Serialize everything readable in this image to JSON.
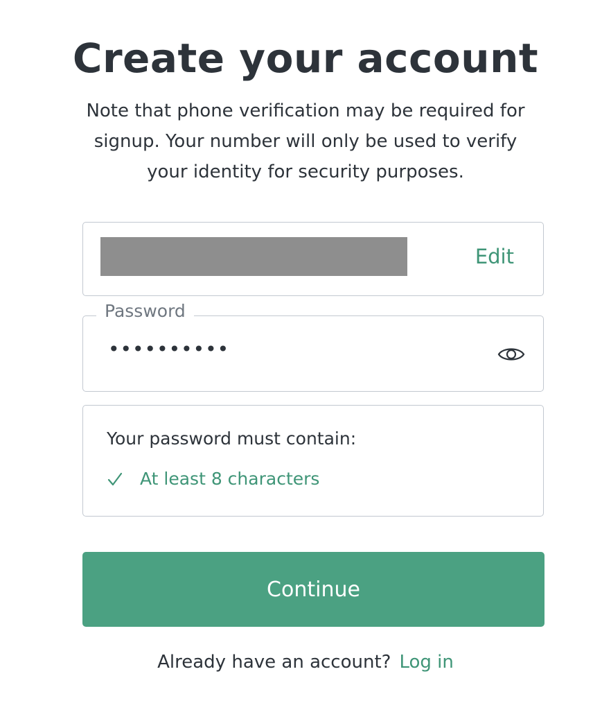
{
  "header": {
    "title": "Create your account",
    "subtitle": "Note that phone verification may be required for signup. Your number will only be used to verify your identity for security purposes."
  },
  "email_field": {
    "value": "",
    "redacted": true,
    "edit_label": "Edit"
  },
  "password_field": {
    "label": "Password",
    "masked_value": "••••••••••",
    "toggle_icon": "eye-icon"
  },
  "password_rules": {
    "title": "Your password must contain:",
    "items": [
      {
        "label": "At least 8 characters",
        "met": true,
        "icon": "check-icon"
      }
    ]
  },
  "actions": {
    "continue_label": "Continue"
  },
  "footer": {
    "prompt": "Already have an account?",
    "login_label": "Log in"
  },
  "colors": {
    "accent": "#4ba182",
    "accent_text": "#3f9577",
    "text": "#2d333a",
    "border": "#c2c8d0",
    "muted": "#6f7780"
  }
}
